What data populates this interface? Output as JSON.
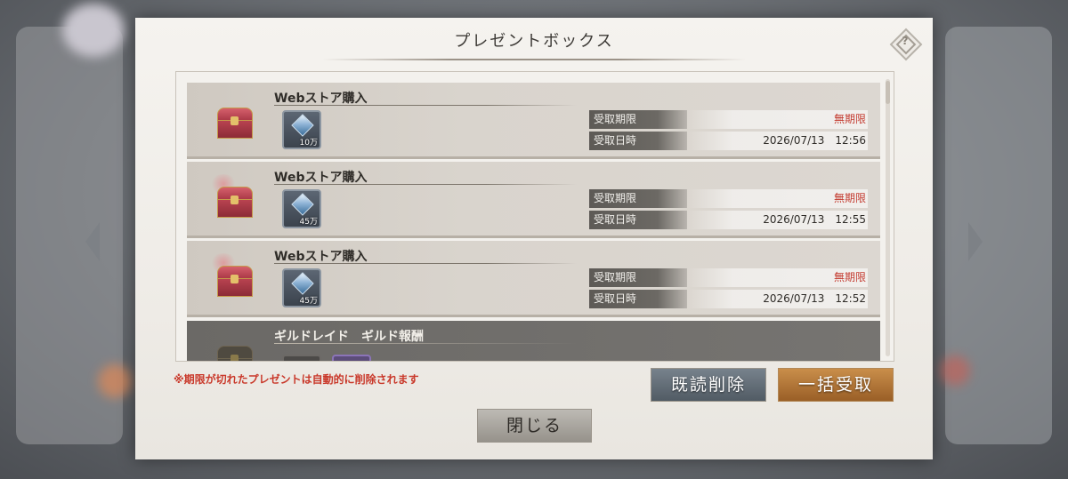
{
  "dialog": {
    "title": "プレゼントボックス"
  },
  "items": [
    {
      "title": "Webストア購入",
      "reward_qty": "10万",
      "expiry_label": "受取期限",
      "expiry_value": "無期限",
      "received_label": "受取日時",
      "received_value": "2026/07/13　12:56"
    },
    {
      "title": "Webストア購入",
      "reward_qty": "45万",
      "expiry_label": "受取期限",
      "expiry_value": "無期限",
      "received_label": "受取日時",
      "received_value": "2026/07/13　12:55"
    },
    {
      "title": "Webストア購入",
      "reward_qty": "45万",
      "expiry_label": "受取期限",
      "expiry_value": "無期限",
      "received_label": "受取日時",
      "received_value": "2026/07/13　12:52"
    },
    {
      "title": "ギルドレイド　ギルド報酬"
    }
  ],
  "footer": {
    "notice": "※期限が切れたプレゼントは自動的に削除されます",
    "delete_read_label": "既読削除",
    "claim_all_label": "一括受取",
    "close_label": "閉じる"
  },
  "colors": {
    "warning_text": "#c9382a",
    "claim_all_button": "#c98e4a",
    "delete_read_button": "#6a7580"
  }
}
